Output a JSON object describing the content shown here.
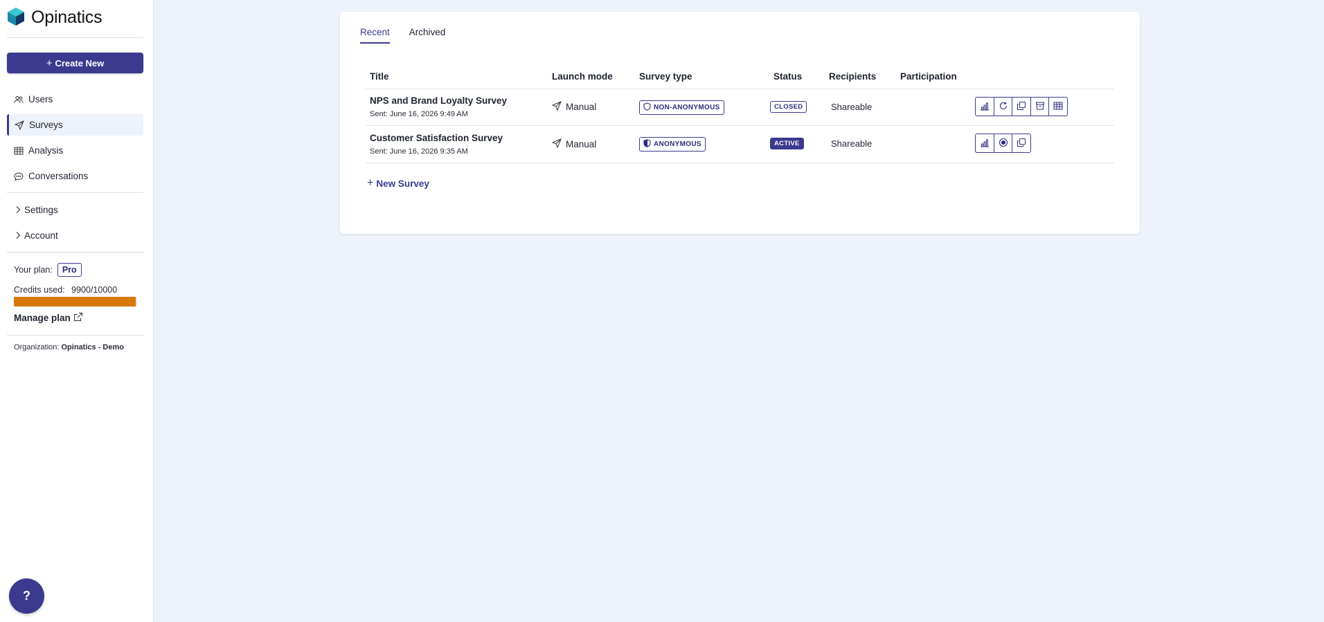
{
  "brand": {
    "name": "Opinatics"
  },
  "sidebar": {
    "create_label": "Create New",
    "nav": [
      {
        "label": "Users",
        "icon": "users-icon"
      },
      {
        "label": "Surveys",
        "icon": "send-icon"
      },
      {
        "label": "Analysis",
        "icon": "table-icon"
      },
      {
        "label": "Conversations",
        "icon": "chat-icon"
      }
    ],
    "groups": [
      {
        "label": "Settings"
      },
      {
        "label": "Account"
      }
    ],
    "plan_label": "Your plan:",
    "plan_value": "Pro",
    "credits_label": "Credits used:",
    "credits_value": "9900/10000",
    "credits_fraction": 0.99,
    "manage_label": "Manage plan",
    "org_label": "Organization:",
    "org_value": "Opinatics - Demo",
    "help_label": "?"
  },
  "main": {
    "tabs": [
      {
        "label": "Recent",
        "active": true
      },
      {
        "label": "Archived",
        "active": false
      }
    ],
    "columns": [
      "Title",
      "Launch mode",
      "Survey type",
      "Status",
      "Recipients",
      "Participation"
    ],
    "rows": [
      {
        "title": "NPS and Brand Loyalty Survey",
        "sent": "Sent: June 16, 2026 9:49 AM",
        "launch": "Manual",
        "type": "NON-ANONYMOUS",
        "status": "CLOSED",
        "recipients": "Shareable",
        "participation": "",
        "actions": [
          "bar-chart-icon",
          "refresh-icon",
          "copy-icon",
          "archive-icon",
          "table-icon"
        ]
      },
      {
        "title": "Customer Satisfaction Survey",
        "sent": "Sent: June 16, 2026 9:35 AM",
        "launch": "Manual",
        "type": "ANONYMOUS",
        "status": "ACTIVE",
        "recipients": "Shareable",
        "participation": "",
        "actions": [
          "bar-chart-icon",
          "stop-circle-icon",
          "copy-icon"
        ]
      }
    ],
    "new_survey_label": "New Survey"
  },
  "colors": {
    "accent": "#3b3a8f",
    "credits_bar": "#d9780a",
    "background": "#eef3fb"
  }
}
